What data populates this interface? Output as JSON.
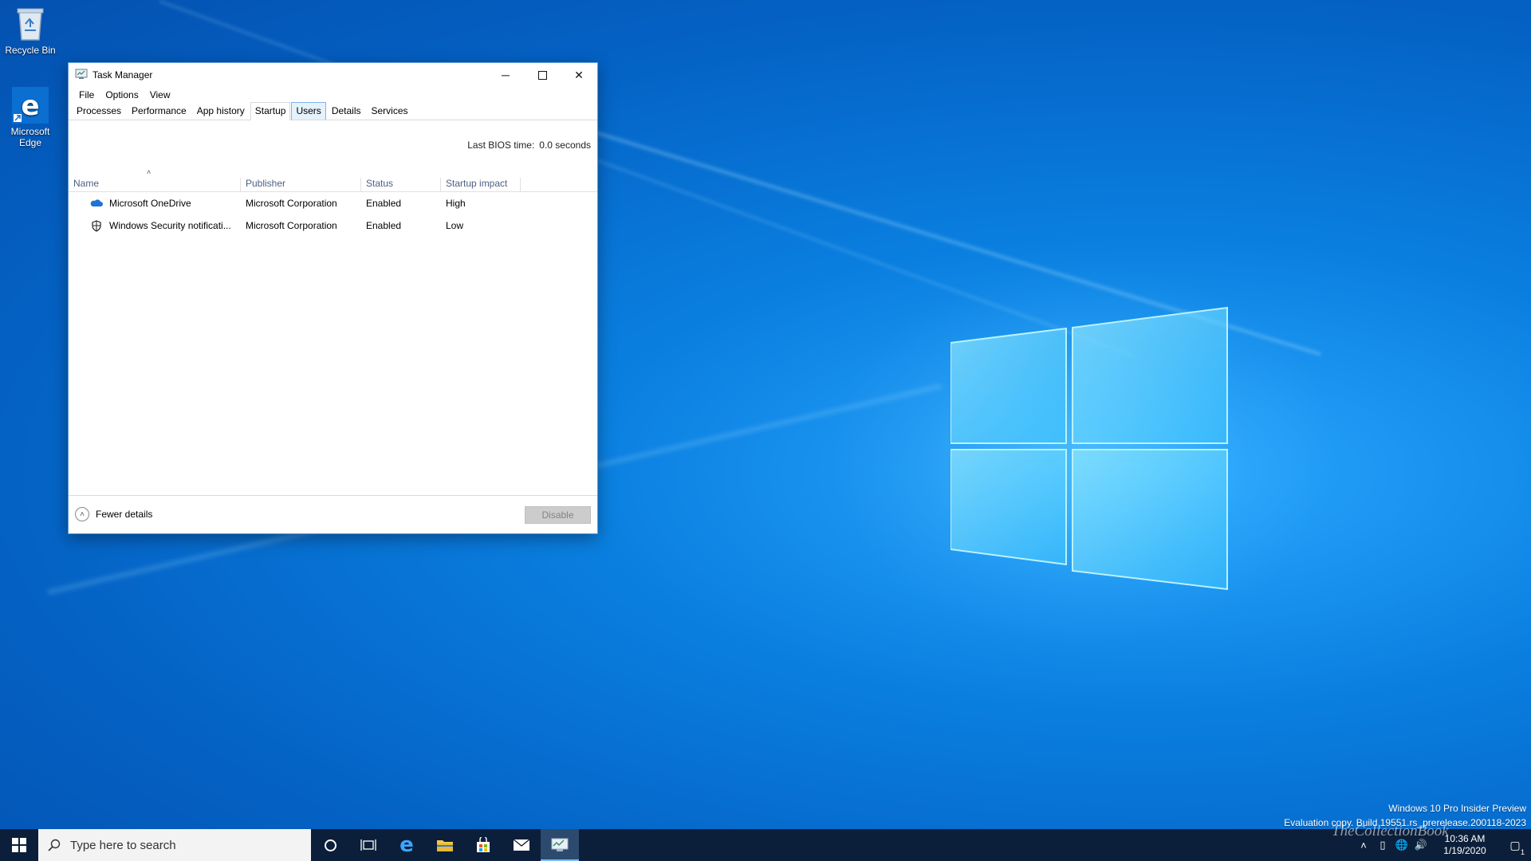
{
  "desktop": {
    "icons": [
      {
        "label": "Recycle Bin",
        "icon": "recycle-bin-icon"
      },
      {
        "label": "Microsoft Edge",
        "icon": "edge-icon"
      }
    ]
  },
  "window": {
    "title": "Task Manager",
    "menu": [
      "File",
      "Options",
      "View"
    ],
    "tabs": [
      "Processes",
      "Performance",
      "App history",
      "Startup",
      "Users",
      "Details",
      "Services"
    ],
    "active_tab": "Startup",
    "bios_label": "Last BIOS time:",
    "bios_value": "0.0 seconds",
    "columns": [
      "Name",
      "Publisher",
      "Status",
      "Startup impact"
    ],
    "rows": [
      {
        "name": "Microsoft OneDrive",
        "publisher": "Microsoft Corporation",
        "status": "Enabled",
        "impact": "High",
        "icon": "onedrive-icon"
      },
      {
        "name": "Windows Security notificati...",
        "publisher": "Microsoft Corporation",
        "status": "Enabled",
        "impact": "Low",
        "icon": "shield-icon"
      }
    ],
    "fewer_details": "Fewer details",
    "disable_label": "Disable"
  },
  "watermark": {
    "line1": "Windows 10 Pro Insider Preview",
    "line2": "Evaluation copy. Build 19551.rs_prerelease.200118-2023"
  },
  "taskbar": {
    "search_placeholder": "Type here to search",
    "time": "10:36 AM",
    "date": "1/19/2020",
    "notification_count": "1",
    "overlay_text": "TheCollectionBook"
  },
  "colors": {
    "accent": "#0078d7",
    "taskbar": "#0c1f3a"
  }
}
